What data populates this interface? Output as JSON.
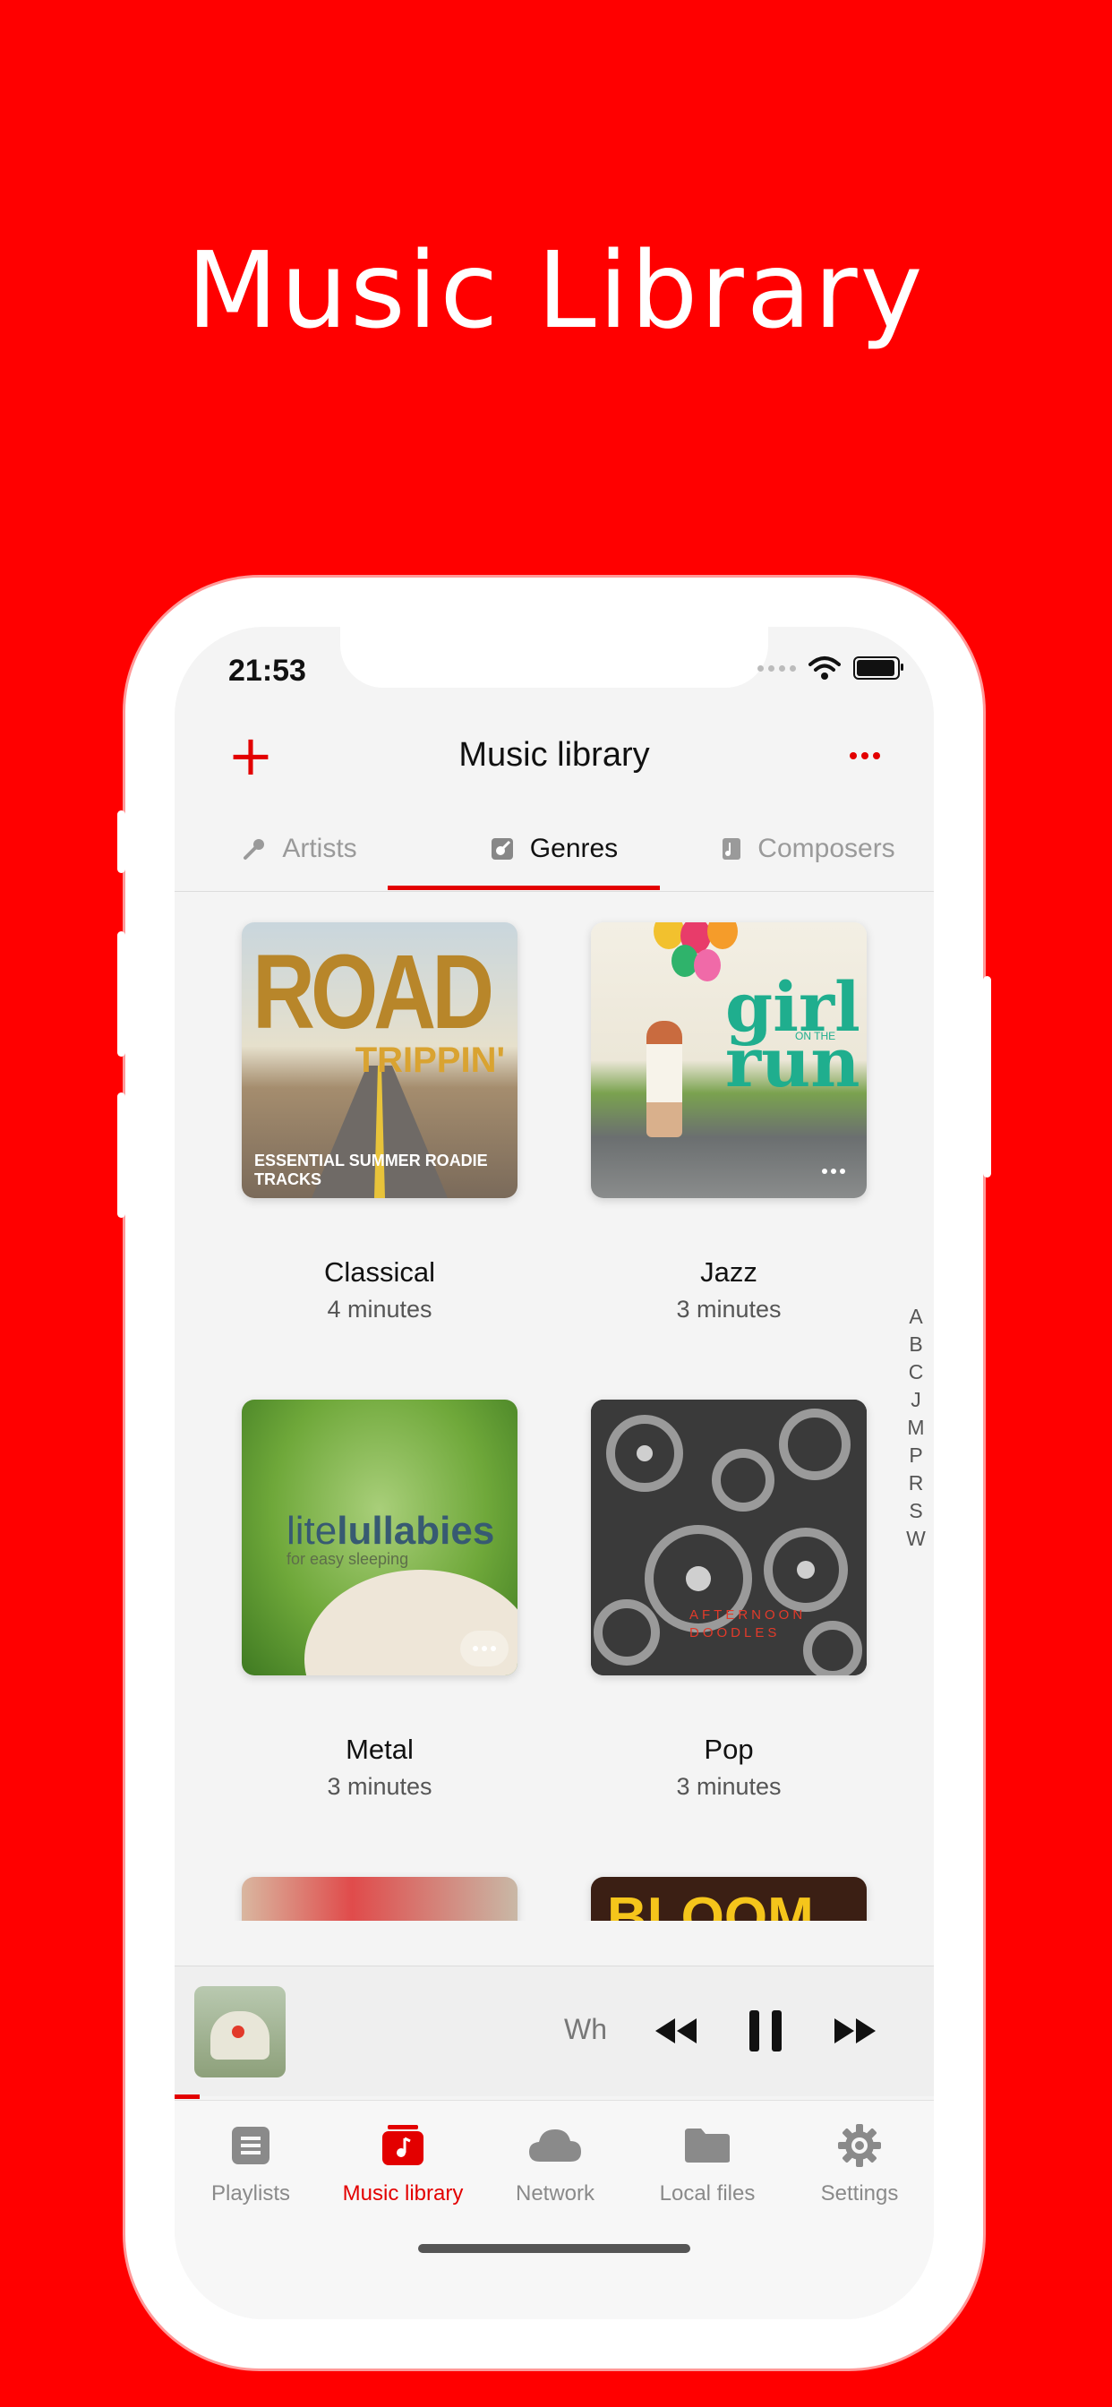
{
  "hero": {
    "title": "Music Library"
  },
  "status": {
    "time": "21:53"
  },
  "nav": {
    "title": "Music library",
    "add_icon": "plus-icon",
    "more_icon": "ellipsis-icon"
  },
  "tabs": [
    {
      "label": "Artists",
      "icon": "microphone-icon",
      "active": false
    },
    {
      "label": "Genres",
      "icon": "guitar-icon",
      "active": true
    },
    {
      "label": "Composers",
      "icon": "music-sheet-icon",
      "active": false
    }
  ],
  "genres": [
    {
      "title": "Classical",
      "subtitle": "4 minutes",
      "cover_text": [
        "ROAD",
        "TRIPPIN'",
        "ESSENTIAL SUMMER ROADIE TRACKS"
      ]
    },
    {
      "title": "Jazz",
      "subtitle": "3 minutes",
      "cover_text": [
        "girl",
        "ON THE",
        "run"
      ]
    },
    {
      "title": "Metal",
      "subtitle": "3 minutes",
      "cover_text": [
        "lite",
        "lullabies",
        "for easy sleeping"
      ]
    },
    {
      "title": "Pop",
      "subtitle": "3 minutes",
      "cover_text": [
        "AFTERNOON",
        "DOODLES"
      ]
    },
    {
      "title": "",
      "subtitle": "",
      "cover_text": []
    },
    {
      "title": "",
      "subtitle": "",
      "cover_text": [
        "BLOOM"
      ]
    }
  ],
  "az_index": [
    "A",
    "B",
    "C",
    "J",
    "M",
    "P",
    "R",
    "S",
    "W"
  ],
  "mini_player": {
    "track_fragment": "Wh",
    "controls": [
      "rewind-icon",
      "pause-icon",
      "fast-forward-icon"
    ]
  },
  "tabbar": [
    {
      "label": "Playlists",
      "icon": "list-icon",
      "active": false
    },
    {
      "label": "Music library",
      "icon": "music-library-icon",
      "active": true
    },
    {
      "label": "Network",
      "icon": "cloud-icon",
      "active": false
    },
    {
      "label": "Local files",
      "icon": "folder-icon",
      "active": false
    },
    {
      "label": "Settings",
      "icon": "gear-icon",
      "active": false
    }
  ],
  "colors": {
    "brand_red": "#ff0000",
    "accent_red": "#e30000",
    "inactive_gray": "#8a8a8a"
  }
}
